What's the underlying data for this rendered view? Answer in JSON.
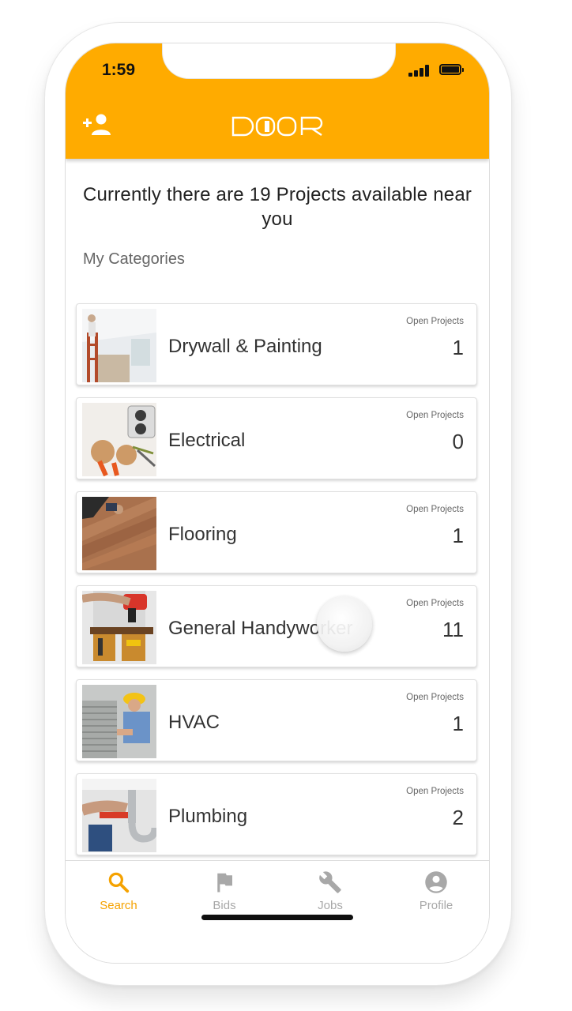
{
  "status_bar": {
    "time": "1:59"
  },
  "header": {
    "logo_text": "DOOR",
    "accent_color": "#ffab00",
    "left_icon": "add-user-icon"
  },
  "intro_text": "Currently there are 19 Projects available near you",
  "section_title": "My Categories",
  "categories": [
    {
      "name": "Drywall & Painting",
      "open_label": "Open Projects",
      "count": "1",
      "image": "drywall-painting-photo"
    },
    {
      "name": "Electrical",
      "open_label": "Open Projects",
      "count": "0",
      "image": "electrical-outlet-photo"
    },
    {
      "name": "Flooring",
      "open_label": "Open Projects",
      "count": "1",
      "image": "wood-flooring-photo"
    },
    {
      "name": "General Handyworker",
      "open_label": "Open Projects",
      "count": "11",
      "image": "handyman-toolbelt-photo"
    },
    {
      "name": "HVAC",
      "open_label": "Open Projects",
      "count": "1",
      "image": "hvac-technician-photo"
    },
    {
      "name": "Plumbing",
      "open_label": "Open Projects",
      "count": "2",
      "image": "sink-pipe-photo"
    }
  ],
  "tabs": [
    {
      "label": "Search",
      "icon": "search-icon",
      "active": true
    },
    {
      "label": "Bids",
      "icon": "flag-icon",
      "active": false
    },
    {
      "label": "Jobs",
      "icon": "wrench-icon",
      "active": false
    },
    {
      "label": "Profile",
      "icon": "account-circle-icon",
      "active": false
    }
  ],
  "colors": {
    "active_tab": "#f5a200",
    "inactive_tab": "#a8a8a8"
  }
}
